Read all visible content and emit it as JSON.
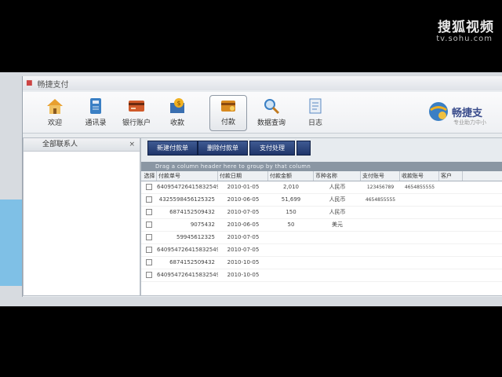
{
  "watermark": {
    "brand": "搜狐视频",
    "domain": "tv.sohu.com"
  },
  "window": {
    "title": "畅捷支付"
  },
  "toolbar": {
    "items": [
      {
        "label": "欢迎",
        "icon": "home-icon",
        "color": "#e89a2a"
      },
      {
        "label": "通讯录",
        "icon": "address-book-icon",
        "color": "#3a7fc4"
      },
      {
        "label": "银行账户",
        "icon": "bank-card-icon",
        "color": "#d05a2a"
      },
      {
        "label": "收款",
        "icon": "receive-money-icon",
        "color": "#e0a020"
      },
      {
        "label": "付款",
        "icon": "payment-icon",
        "color": "#d88a20"
      },
      {
        "label": "数据查询",
        "icon": "search-icon",
        "color": "#3a7fc4"
      },
      {
        "label": "日志",
        "icon": "log-icon",
        "color": "#5a8ac4"
      }
    ],
    "active_label": "付款",
    "brand_title": "畅捷支",
    "brand_sub": "专业助力中小"
  },
  "left_panel": {
    "title": "全部联系人",
    "close_symbol": "×"
  },
  "actions": {
    "new": "新建付款单",
    "delete": "删除付款单",
    "pay": "支付处理",
    "extra": "",
    "group_hint": "Drag a column header here to group by that column"
  },
  "table": {
    "headers": [
      "选择",
      "付款单号",
      "付款日期",
      "付款金额",
      "币种名称",
      "支付账号",
      "收款账号",
      "客户"
    ],
    "rows": [
      {
        "no": "640954726415832549",
        "date": "2010-01-05",
        "amount": "2,010",
        "currency": "人民币",
        "pay": "123456789",
        "recv": "4654855555",
        "cust": ""
      },
      {
        "no": "4325598456125325",
        "date": "2010-06-05",
        "amount": "51,699",
        "currency": "人民币",
        "pay": "4654855555",
        "recv": "",
        "cust": ""
      },
      {
        "no": "6874152509432",
        "date": "2010-07-05",
        "amount": "150",
        "currency": "人民币",
        "pay": "",
        "recv": "",
        "cust": ""
      },
      {
        "no": "9075432",
        "date": "2010-06-05",
        "amount": "50",
        "currency": "美元",
        "pay": "",
        "recv": "",
        "cust": ""
      },
      {
        "no": "59945612325",
        "date": "2010-07-05",
        "amount": "",
        "currency": "",
        "pay": "",
        "recv": "",
        "cust": ""
      },
      {
        "no": "640954726415832549",
        "date": "2010-07-05",
        "amount": "",
        "currency": "",
        "pay": "",
        "recv": "",
        "cust": ""
      },
      {
        "no": "6874152509432",
        "date": "2010-10-05",
        "amount": "",
        "currency": "",
        "pay": "",
        "recv": "",
        "cust": ""
      },
      {
        "no": "640954726415832549",
        "date": "2010-10-05",
        "amount": "",
        "currency": "",
        "pay": "",
        "recv": "",
        "cust": ""
      }
    ]
  }
}
